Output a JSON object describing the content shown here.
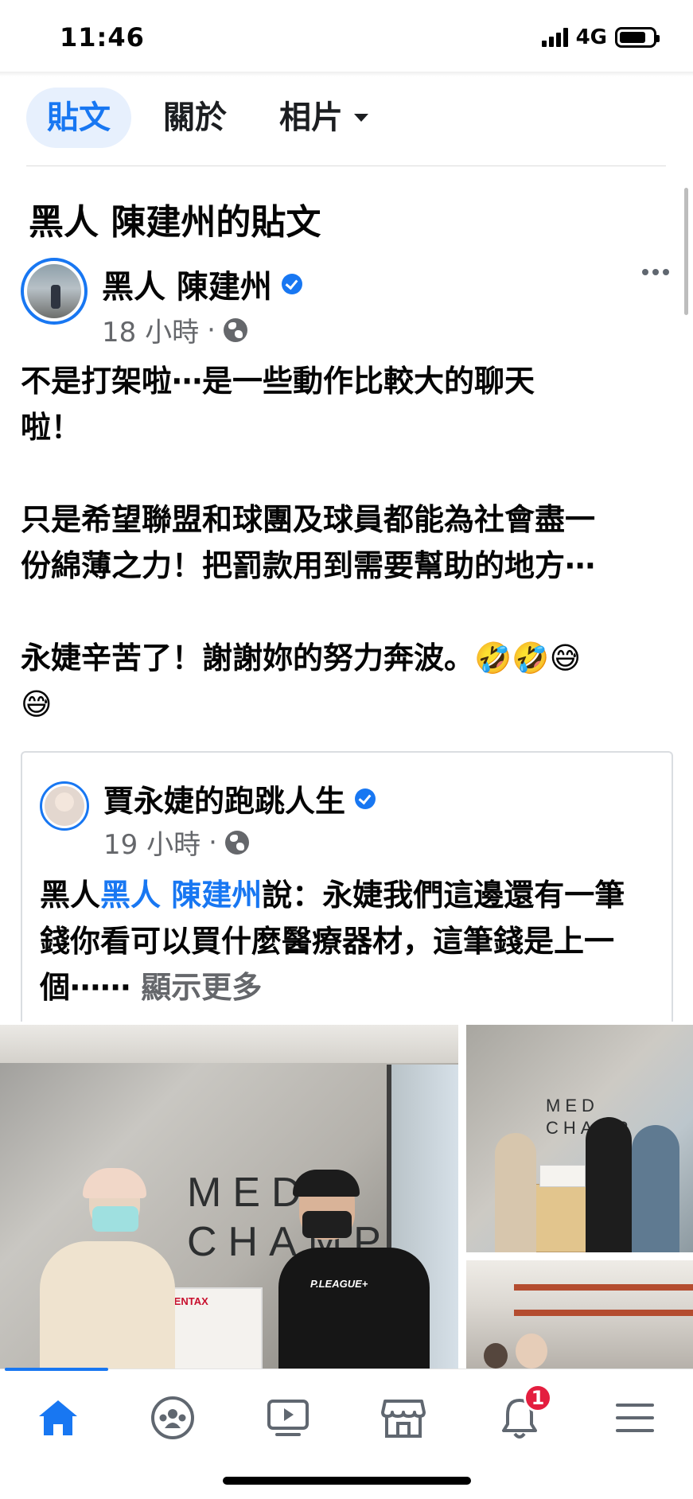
{
  "status_bar": {
    "time": "11:46",
    "network": "4G",
    "battery_level": 0.8
  },
  "tabs": [
    {
      "label": "貼文",
      "active": true
    },
    {
      "label": "關於",
      "active": false
    },
    {
      "label": "相片",
      "active": false,
      "has_dropdown": true
    }
  ],
  "section_title": "黑人 陳建州的貼文",
  "post": {
    "author": "黑人 陳建州",
    "verified": true,
    "time": "18 小時",
    "separator": "·",
    "privacy_icon": "globe-icon",
    "more_icon": "more-options-icon",
    "text": "不是打架啦⋯是一些動作比較大的聊天\n啦！\n\n只是希望聯盟和球團及球員都能為社會盡一\n份綿薄之力！把罰款用到需要幫助的地方⋯\n\n永婕辛苦了！謝謝妳的努力奔波。🤣🤣😅\n😅"
  },
  "shared_post": {
    "author": "賈永婕的跑跳人生",
    "verified": true,
    "time": "19 小時",
    "separator": "·",
    "text_prefix": "黑人",
    "mention": "黑人 陳建州",
    "text_body": "說：永婕我們這邊還有一筆錢你看可以買什麼醫療器材，這筆錢是上一個⋯⋯ ",
    "see_more": "顯示更多"
  },
  "photos": {
    "logo_line1": "MED",
    "logo_line2": "CHAMP",
    "box_label": "PENTAX",
    "shirt_text": "P.LEAGUE+"
  },
  "bottom_nav": {
    "items": [
      {
        "name": "home",
        "active": true
      },
      {
        "name": "groups",
        "active": false
      },
      {
        "name": "watch",
        "active": false
      },
      {
        "name": "marketplace",
        "active": false
      },
      {
        "name": "notifications",
        "active": false,
        "badge": "1"
      },
      {
        "name": "menu",
        "active": false
      }
    ]
  },
  "colors": {
    "accent": "#1877f2",
    "badge": "#e41e3f",
    "meta_text": "#65676b",
    "active_tab_bg": "#e7f0fd"
  }
}
